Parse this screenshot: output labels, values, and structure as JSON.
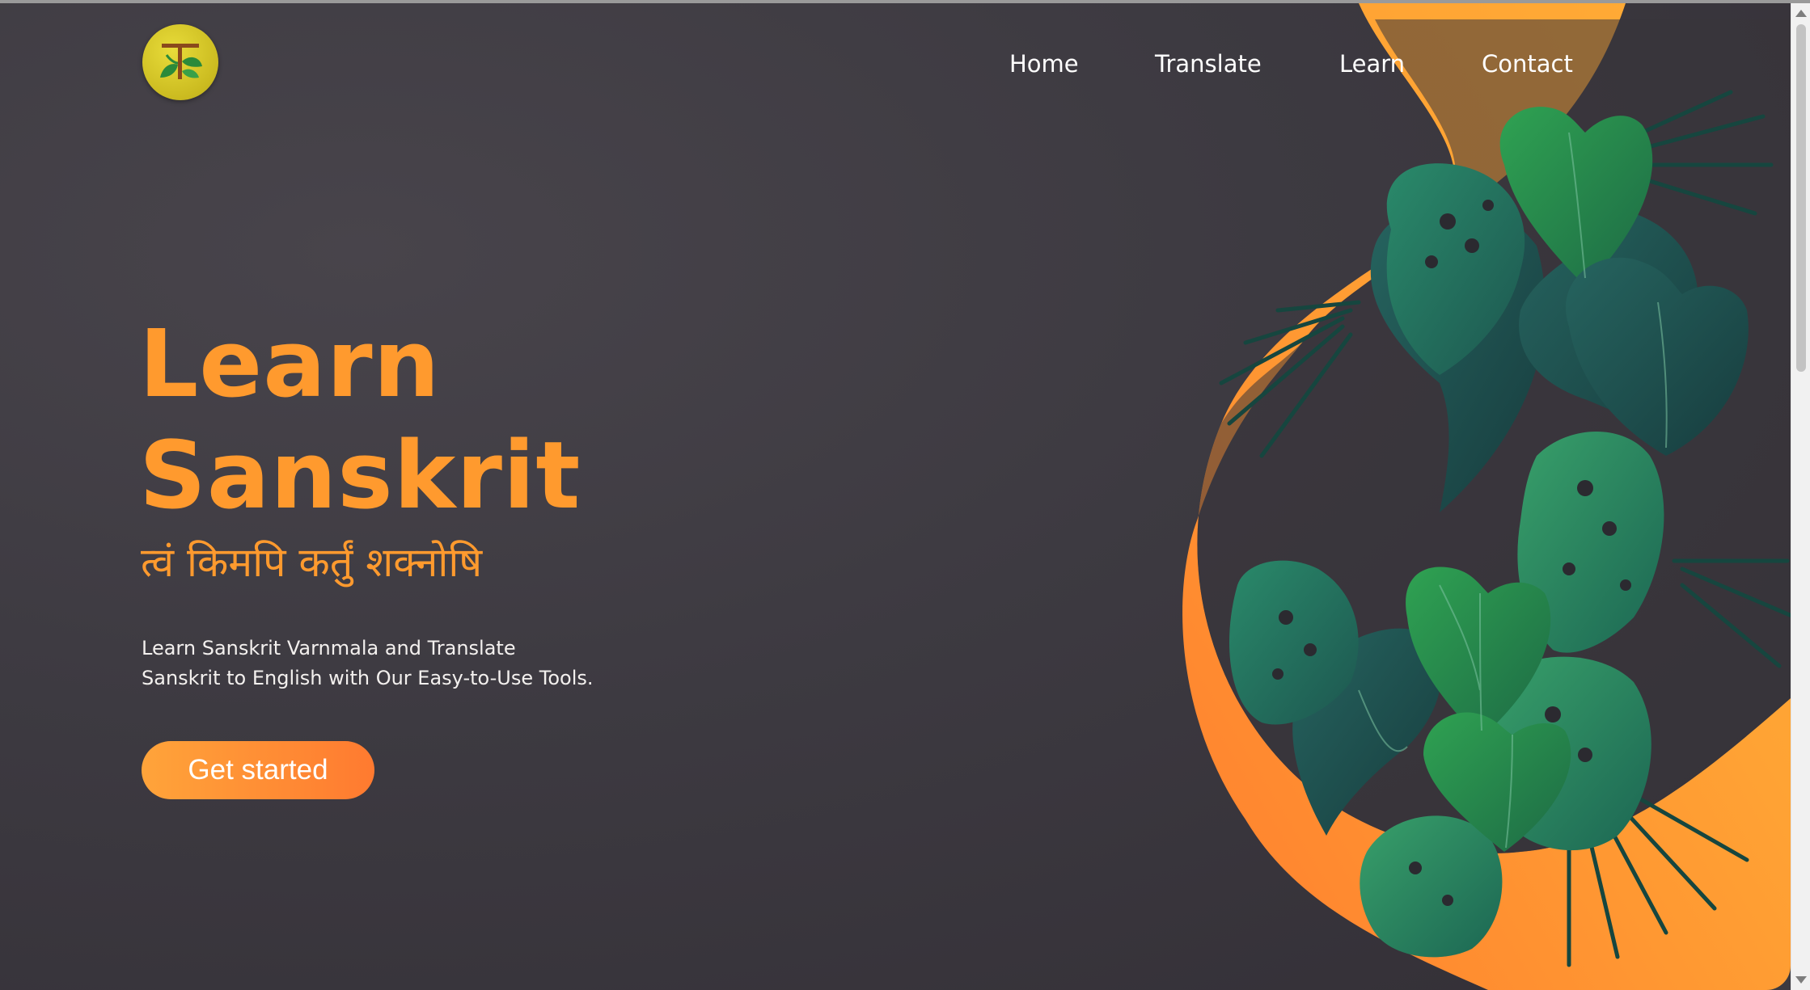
{
  "brand": {
    "logo_icon": "leaf-emblem-icon",
    "colors": {
      "accent": "#ff9a2e",
      "background": "#3c3a40",
      "leaf_dark": "#1f5a55",
      "leaf_green": "#2e9a55",
      "logo_yellow": "#d4c52a"
    }
  },
  "nav": {
    "items": [
      {
        "label": "Home"
      },
      {
        "label": "Translate"
      },
      {
        "label": "Learn"
      },
      {
        "label": "Contact"
      }
    ]
  },
  "hero": {
    "title_line1": "Learn",
    "title_line2": "Sanskrit",
    "subtitle": "त्वं किमपि कर्तुं शक्नोषि",
    "description": "Learn Sanskrit Varnmala and Translate Sanskrit to English with Our Easy-to-Use Tools.",
    "cta_label": "Get started"
  }
}
